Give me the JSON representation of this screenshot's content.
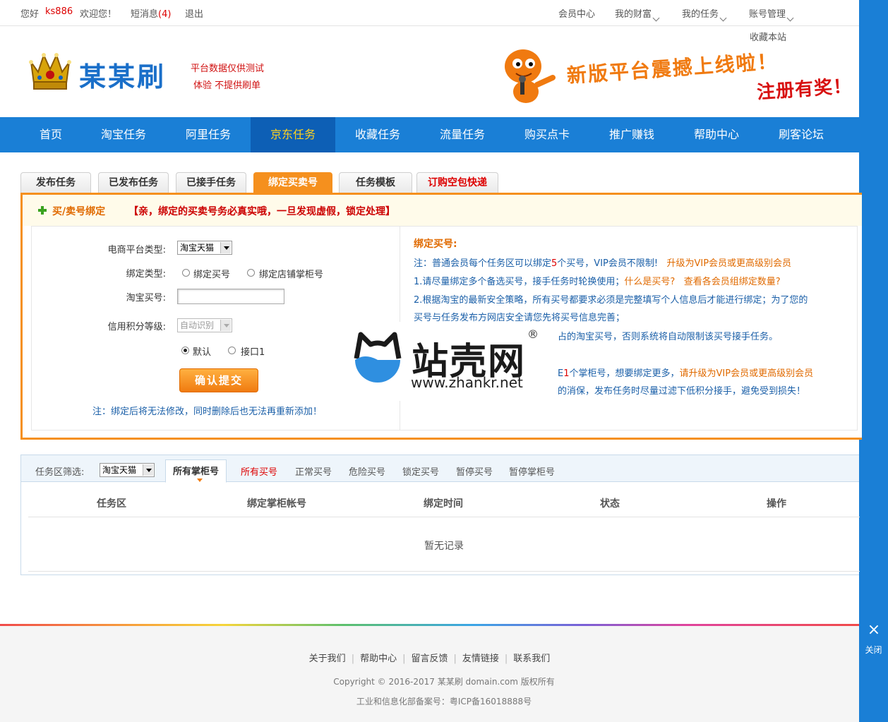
{
  "topbar": {
    "hello": "您好",
    "username": "ks886",
    "welcome": "欢迎您！",
    "messages": "短消息",
    "messages_count": "(4)",
    "logout": "退出",
    "member_center": "会员中心",
    "my_wealth": "我的财富",
    "my_tasks": "我的任务",
    "account": "账号管理",
    "bookmark": "收藏本站"
  },
  "header": {
    "logo_text": "某某刷",
    "slogan_line1": "平台数据仅供测试",
    "slogan_line2": "体验   不提供刷单",
    "banner_line1": "新版平台震撼上线啦！",
    "banner_line2": "注册有奖！"
  },
  "nav": {
    "items": [
      "首页",
      "淘宝任务",
      "阿里任务",
      "京东任务",
      "收藏任务",
      "流量任务",
      "购买点卡",
      "推广赚钱",
      "帮助中心",
      "刷客论坛"
    ],
    "active_index": 3
  },
  "tabs": [
    "发布任务",
    "已发布任务",
    "已接手任务",
    "绑定买卖号",
    "任务模板",
    "订购空包快递"
  ],
  "panel": {
    "title": "买/卖号绑定",
    "warning": "【亲，绑定的买卖号务必真实哦，一旦发现虚假，锁定处理】",
    "platform_label": "电商平台类型:",
    "platform_value": "淘宝天猫",
    "bind_type_label": "绑定类型:",
    "bind_buyer": "绑定买号",
    "bind_shop": "绑定店铺掌柜号",
    "taobao_label": "淘宝买号:",
    "taobao_value": "",
    "credit_label": "信用积分等级:",
    "credit_value": "自动识别",
    "default_option": "默认",
    "api_option": "接口1",
    "submit": "确认提交",
    "note": "注：绑定后将无法修改，同时删除后也无法再重新添加！"
  },
  "info": {
    "title": "绑定买号:",
    "line1_a": "注：普通会员每个任务区可以绑定",
    "line1_num": "5",
    "line1_b": "个买号，VIP会员不限制!",
    "line1_link": "升级为VIP会员或更高级别会员",
    "line2_a": "1.请尽量绑定多个备选买号，接手任务时轮换使用；",
    "line2_link1": "什么是买号?",
    "line2_link2": "查看各会员组绑定数量?",
    "line3": "2.根据淘宝的最新安全策略，所有买号都要求必须是完整填写个人信息后才能进行绑定；为了您的",
    "line4": "买号与任务发布方网店安全请您先将买号信息完善；",
    "line5": "占的淘宝买号，否则系统将自动限制该买号接手任务。",
    "line6_a": "E",
    "line6_num": "1",
    "line6_b": "个掌柜号，想要绑定更多，",
    "line6_link": "请升级为VIP会员或更高级别会员",
    "line7": "的消保，发布任务时尽量过滤下低积分接手，避免受到损失！"
  },
  "watermark": {
    "brand": "站壳网",
    "reg": "®",
    "url": "www.zhankr.net"
  },
  "lower": {
    "filter_label": "任务区筛选:",
    "filter_value": "淘宝天猫",
    "tabs": [
      "所有掌柜号",
      "所有买号",
      "正常买号",
      "危险买号",
      "锁定买号",
      "暂停买号",
      "暂停掌柜号"
    ],
    "columns": [
      "任务区",
      "绑定掌柜帐号",
      "绑定时间",
      "状态",
      "操作"
    ],
    "empty": "暂无记录"
  },
  "footer": {
    "links": [
      "关于我们",
      "帮助中心",
      "留言反馈",
      "友情链接",
      "联系我们"
    ],
    "copyright": "Copyright © 2016-2017 某某刷  domain.com 版权所有",
    "icp": "工业和信息化部备案号：粤ICP备16018888号"
  },
  "side": {
    "close_label": "关闭",
    "close_icon": "×"
  }
}
